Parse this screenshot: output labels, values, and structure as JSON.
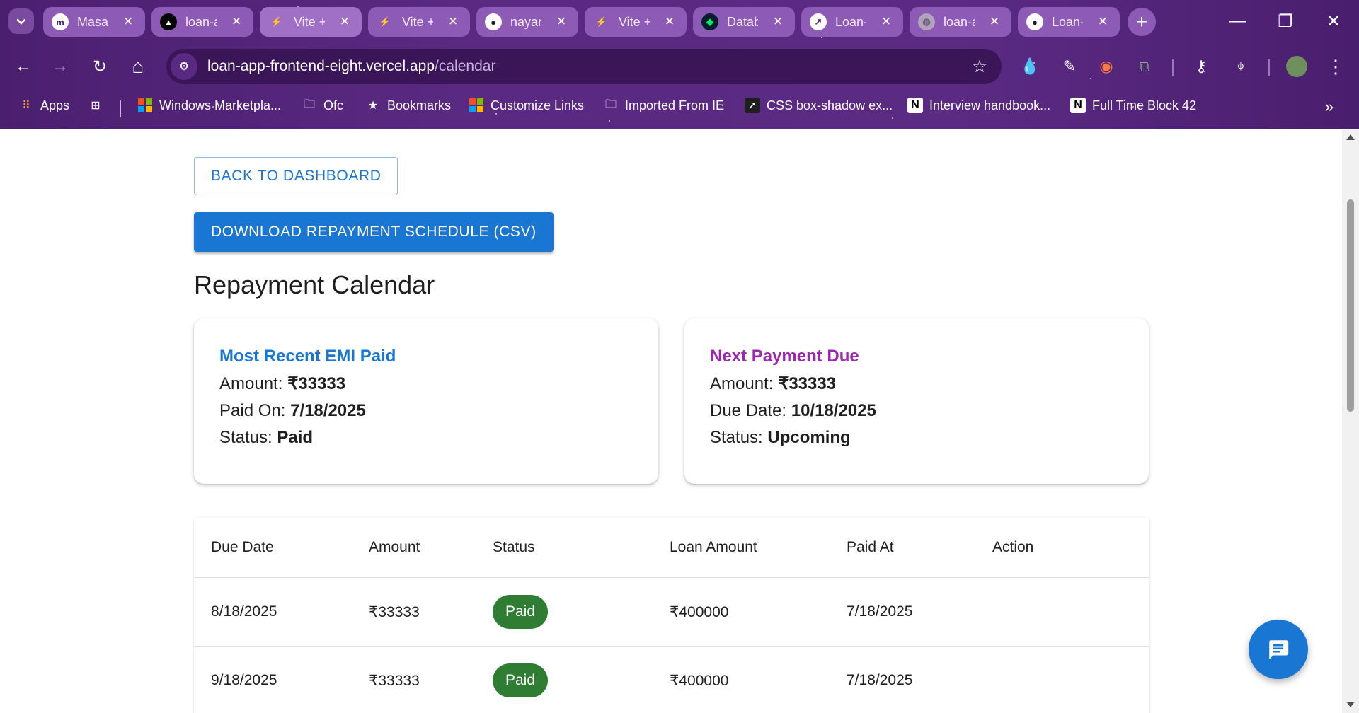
{
  "browser": {
    "tabs": [
      {
        "title": "Masai School",
        "favicon": "masai-icon",
        "favicon_text": "m",
        "favicon_bg": "#ffffff",
        "favicon_fg": "#4b1f70"
      },
      {
        "title": "loan-app",
        "favicon": "vercel-icon",
        "favicon_text": "▲",
        "favicon_bg": "#000000",
        "favicon_fg": "#ffffff"
      },
      {
        "title": "Vite + React",
        "favicon": "vite-icon",
        "favicon_text": "⚡",
        "favicon_bg": "transparent",
        "favicon_fg": "#ffd62e",
        "active": true
      },
      {
        "title": "Vite + React",
        "favicon": "vite-icon",
        "favicon_text": "⚡",
        "favicon_bg": "transparent",
        "favicon_fg": "#ffd62e"
      },
      {
        "title": "nayan",
        "favicon": "github-icon",
        "favicon_text": "●",
        "favicon_bg": "#ffffff",
        "favicon_fg": "#1f1f1f"
      },
      {
        "title": "Vite + React",
        "favicon": "vite-icon",
        "favicon_text": "⚡",
        "favicon_bg": "transparent",
        "favicon_fg": "#ffd62e"
      },
      {
        "title": "Database",
        "favicon": "mongodb-icon",
        "favicon_text": "◆",
        "favicon_bg": "#001e2b",
        "favicon_fg": "#00ed64"
      },
      {
        "title": "Loan-App",
        "favicon": "render-icon",
        "favicon_text": "↗",
        "favicon_bg": "#ffffff",
        "favicon_fg": "#5a2a82"
      },
      {
        "title": "loan-app",
        "favicon": "globe-icon",
        "favicon_text": "◍",
        "favicon_bg": "#b0a4bd",
        "favicon_fg": "#6d5a80"
      },
      {
        "title": "Loan-App",
        "favicon": "github-icon",
        "favicon_text": "●",
        "favicon_bg": "#ffffff",
        "favicon_fg": "#1f1f1f"
      }
    ],
    "new_tab_label": "+",
    "window_controls": {
      "minimize": "—",
      "restore": "❐",
      "close": "✕"
    },
    "nav": {
      "back": "←",
      "forward": "→",
      "reload": "↻",
      "home": "⌂"
    },
    "url_host": "loan-app-frontend-eight.vercel.app",
    "url_path": "/calendar",
    "bookmarks": [
      {
        "label": "Apps",
        "icon": "apps-grid-icon",
        "glyph": "⠿"
      },
      {
        "label": "Windows Marketpla...",
        "icon": "microsoft-icon",
        "glyph": "▦"
      },
      {
        "label": "Ofc",
        "icon": "folder-icon",
        "glyph": "🗀"
      },
      {
        "label": "Bookmarks",
        "icon": "star-icon",
        "glyph": "★"
      },
      {
        "label": "Customize Links",
        "icon": "microsoft-icon",
        "glyph": "▦"
      },
      {
        "label": "Imported From IE",
        "icon": "folder-icon",
        "glyph": "🗀"
      },
      {
        "label": "CSS box-shadow ex...",
        "icon": "cursor-icon",
        "glyph": "➚"
      },
      {
        "label": "Interview handbook...",
        "icon": "notion-icon",
        "glyph": "N"
      },
      {
        "label": "Full Time Block 42",
        "icon": "notion-icon",
        "glyph": "N"
      }
    ],
    "bookmarks_more": "»"
  },
  "page": {
    "back_button": "BACK TO DASHBOARD",
    "download_button": "DOWNLOAD REPAYMENT SCHEDULE (CSV)",
    "title": "Repayment Calendar",
    "recent_card": {
      "title": "Most Recent EMI Paid",
      "title_color": "#1976d2",
      "amount_label": "Amount:",
      "amount_value": "₹33333",
      "date_label": "Paid On:",
      "date_value": "7/18/2025",
      "status_label": "Status:",
      "status_value": "Paid"
    },
    "next_card": {
      "title": "Next Payment Due",
      "title_color": "#9c27b0",
      "amount_label": "Amount:",
      "amount_value": "₹33333",
      "date_label": "Due Date:",
      "date_value": "10/18/2025",
      "status_label": "Status:",
      "status_value": "Upcoming"
    },
    "table": {
      "columns": [
        "Due Date",
        "Amount",
        "Status",
        "Loan Amount",
        "Paid At",
        "Action"
      ],
      "rows": [
        {
          "due_date": "8/18/2025",
          "amount": "₹33333",
          "status": "Paid",
          "loan_amount": "₹400000",
          "paid_at": "7/18/2025",
          "action": ""
        },
        {
          "due_date": "9/18/2025",
          "amount": "₹33333",
          "status": "Paid",
          "loan_amount": "₹400000",
          "paid_at": "7/18/2025",
          "action": ""
        }
      ],
      "status_paid_color": "#2e7d32"
    },
    "fab_icon": "chat-icon"
  }
}
